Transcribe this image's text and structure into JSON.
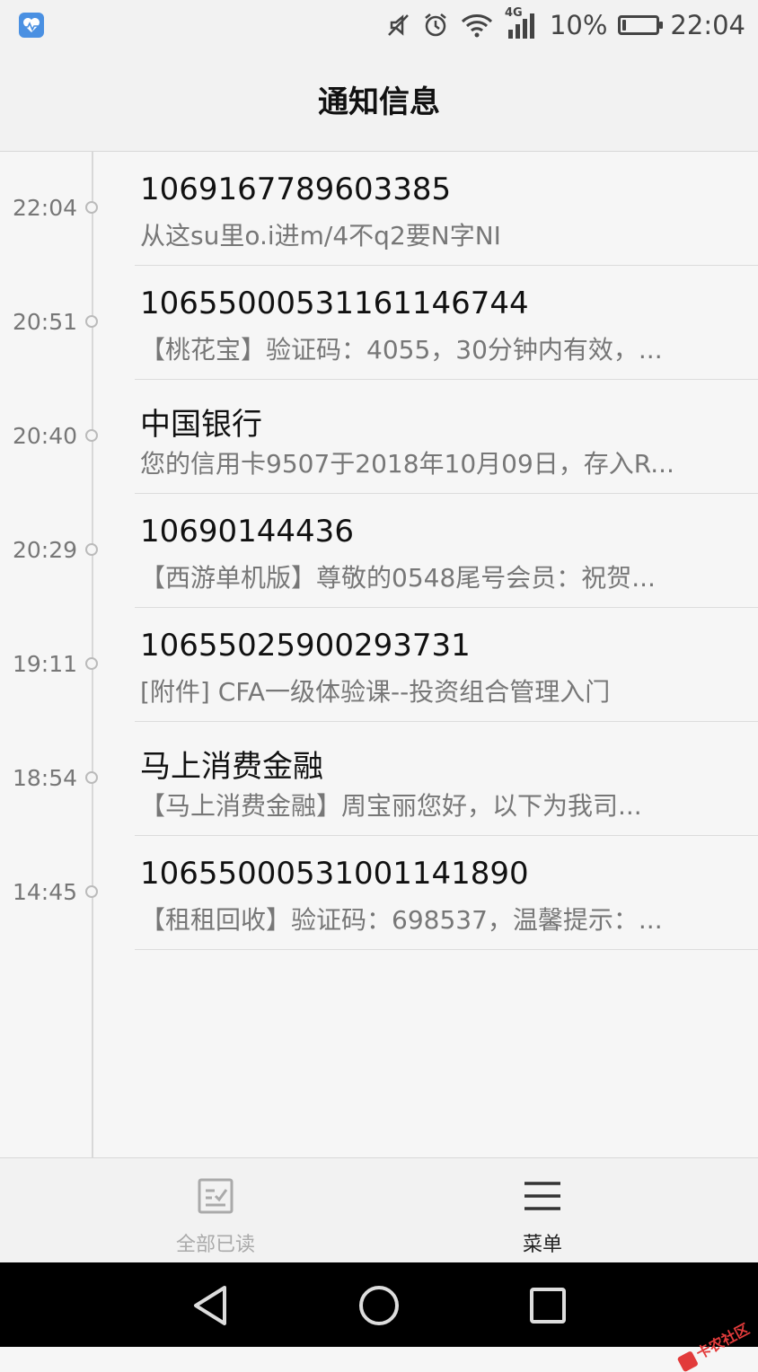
{
  "status_bar": {
    "network_label": "4G",
    "battery_level": 0.1,
    "battery_text": "10%",
    "time": "22:04"
  },
  "header": {
    "title": "通知信息"
  },
  "messages": [
    {
      "time": "22:04",
      "sender": "1069167789603385",
      "preview": "从这su里o.i进m/4不q2要N字NI"
    },
    {
      "time": "20:51",
      "sender": "1065500053116114​6744",
      "preview": "【桃花宝】验证码：4055，30分钟内有效，..."
    },
    {
      "time": "20:40",
      "sender": "中国银行",
      "preview": "您的信用卡9507于2018年10月09日，存入R..."
    },
    {
      "time": "20:29",
      "sender": "10690144436",
      "preview": "【西游单机版】尊敬的0548尾号会员：祝贺..."
    },
    {
      "time": "19:11",
      "sender": "10655025900293731",
      "preview": "[附件] CFA一级体验课--投资组合管理入门"
    },
    {
      "time": "18:54",
      "sender": "马上消费金融",
      "preview": "【马上消费金融】周宝丽您好，以下为我司..."
    },
    {
      "time": "14:45",
      "sender": "10655000531001141890",
      "preview": "【租租回收】验证码：698537，温馨提示：..."
    }
  ],
  "toolbar": {
    "mark_all_read_label": "全部已读",
    "menu_label": "菜单"
  },
  "watermark": {
    "text": "卡农社区"
  },
  "colors": {
    "accent_app_icon": "#4a90e2",
    "background": "#f6f6f6",
    "nav_bar": "#000000",
    "watermark": "#e23b3b"
  }
}
